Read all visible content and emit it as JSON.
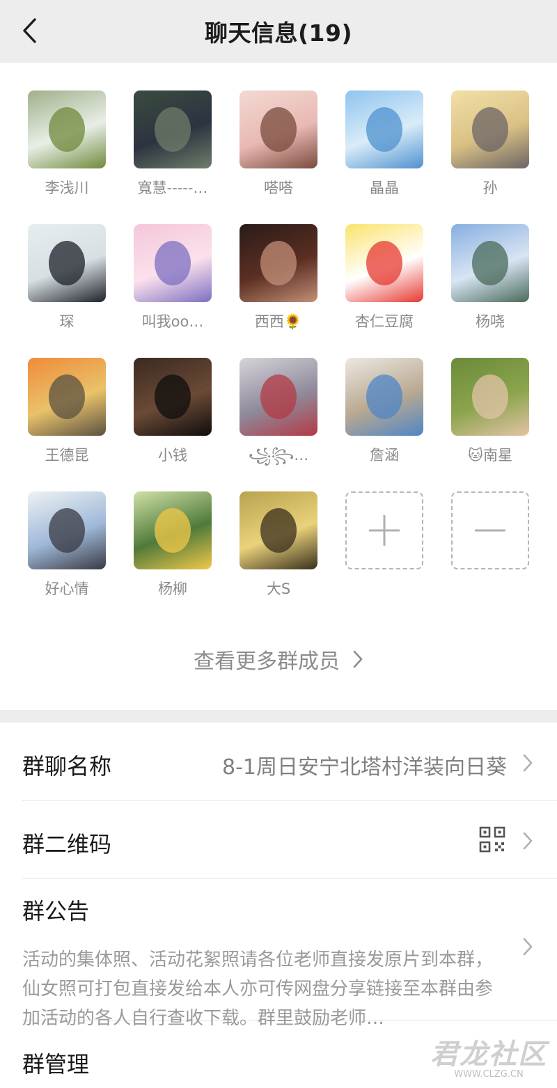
{
  "header": {
    "title": "聊天信息(19)"
  },
  "members": [
    {
      "name": "李浅川",
      "colors": [
        "#9fb08a",
        "#6f8a3c",
        "#e8eee6"
      ]
    },
    {
      "name": "寬慧-----…",
      "colors": [
        "#3b4b3f",
        "#6e7e6a",
        "#2c3340"
      ]
    },
    {
      "name": "嗒嗒",
      "colors": [
        "#f3d9d2",
        "#7a4b3c",
        "#e9b9b4"
      ]
    },
    {
      "name": "晶晶",
      "colors": [
        "#8fc4ef",
        "#4f91cf",
        "#d9ecf8"
      ]
    },
    {
      "name": "孙",
      "colors": [
        "#f2e0a8",
        "#6b6466",
        "#d9c184"
      ]
    },
    {
      "name": "琛",
      "colors": [
        "#e6eef0",
        "#1e222b",
        "#d7dfe2"
      ]
    },
    {
      "name": "叫我oo…",
      "colors": [
        "#f4c6da",
        "#7d6fc2",
        "#fbe1ec"
      ]
    },
    {
      "name": "西西🌻",
      "colors": [
        "#2a1b18",
        "#c38f78",
        "#5b2f22"
      ]
    },
    {
      "name": "杏仁豆腐",
      "colors": [
        "#fbe36b",
        "#e63a32",
        "#ffffff"
      ]
    },
    {
      "name": "杨哓",
      "colors": [
        "#87aee0",
        "#4a6a5b",
        "#d8e5f3"
      ]
    },
    {
      "name": "王德昆",
      "colors": [
        "#f08b3a",
        "#5b5142",
        "#e9c26a"
      ]
    },
    {
      "name": "小钱",
      "colors": [
        "#3b2a21",
        "#0f0d0c",
        "#6b4a36"
      ]
    },
    {
      "name": "꧁꧂…",
      "colors": [
        "#d7d4d9",
        "#b33a44",
        "#8f8a9b"
      ]
    },
    {
      "name": "詹涵",
      "colors": [
        "#ece8e3",
        "#4f86c6",
        "#b9a990"
      ]
    },
    {
      "name": "🐱南星",
      "colors": [
        "#6b8a3a",
        "#e3c3a8",
        "#8ca54d"
      ]
    },
    {
      "name": "好心情",
      "colors": [
        "#eef2f4",
        "#3a3a44",
        "#9fb8d8"
      ]
    },
    {
      "name": "杨柳",
      "colors": [
        "#cfe0a6",
        "#f2c84a",
        "#4f7a3a"
      ]
    },
    {
      "name": "大S",
      "colors": [
        "#b9a24f",
        "#3a2f1e",
        "#e9d27a"
      ]
    }
  ],
  "member_actions": {
    "add_icon": "plus-icon",
    "remove_icon": "minus-icon"
  },
  "more_members": {
    "label": "查看更多群成员"
  },
  "settings": {
    "group_name": {
      "label": "群聊名称",
      "value": "8-1周日安宁北塔村洋装向日葵"
    },
    "qr_code": {
      "label": "群二维码",
      "icon": "qr-code-icon"
    },
    "notice": {
      "label": "群公告",
      "text": "活动的集体照、活动花絮照请各位老师直接发原片到本群，仙女照可打包直接发给本人亦可传网盘分享链接至本群由参加活动的各人自行查收下载。群里鼓励老师…"
    },
    "manage": {
      "label": "群管理"
    }
  },
  "watermark": {
    "main": "君龙社区",
    "sub": "WWW.CLZG.CN"
  }
}
